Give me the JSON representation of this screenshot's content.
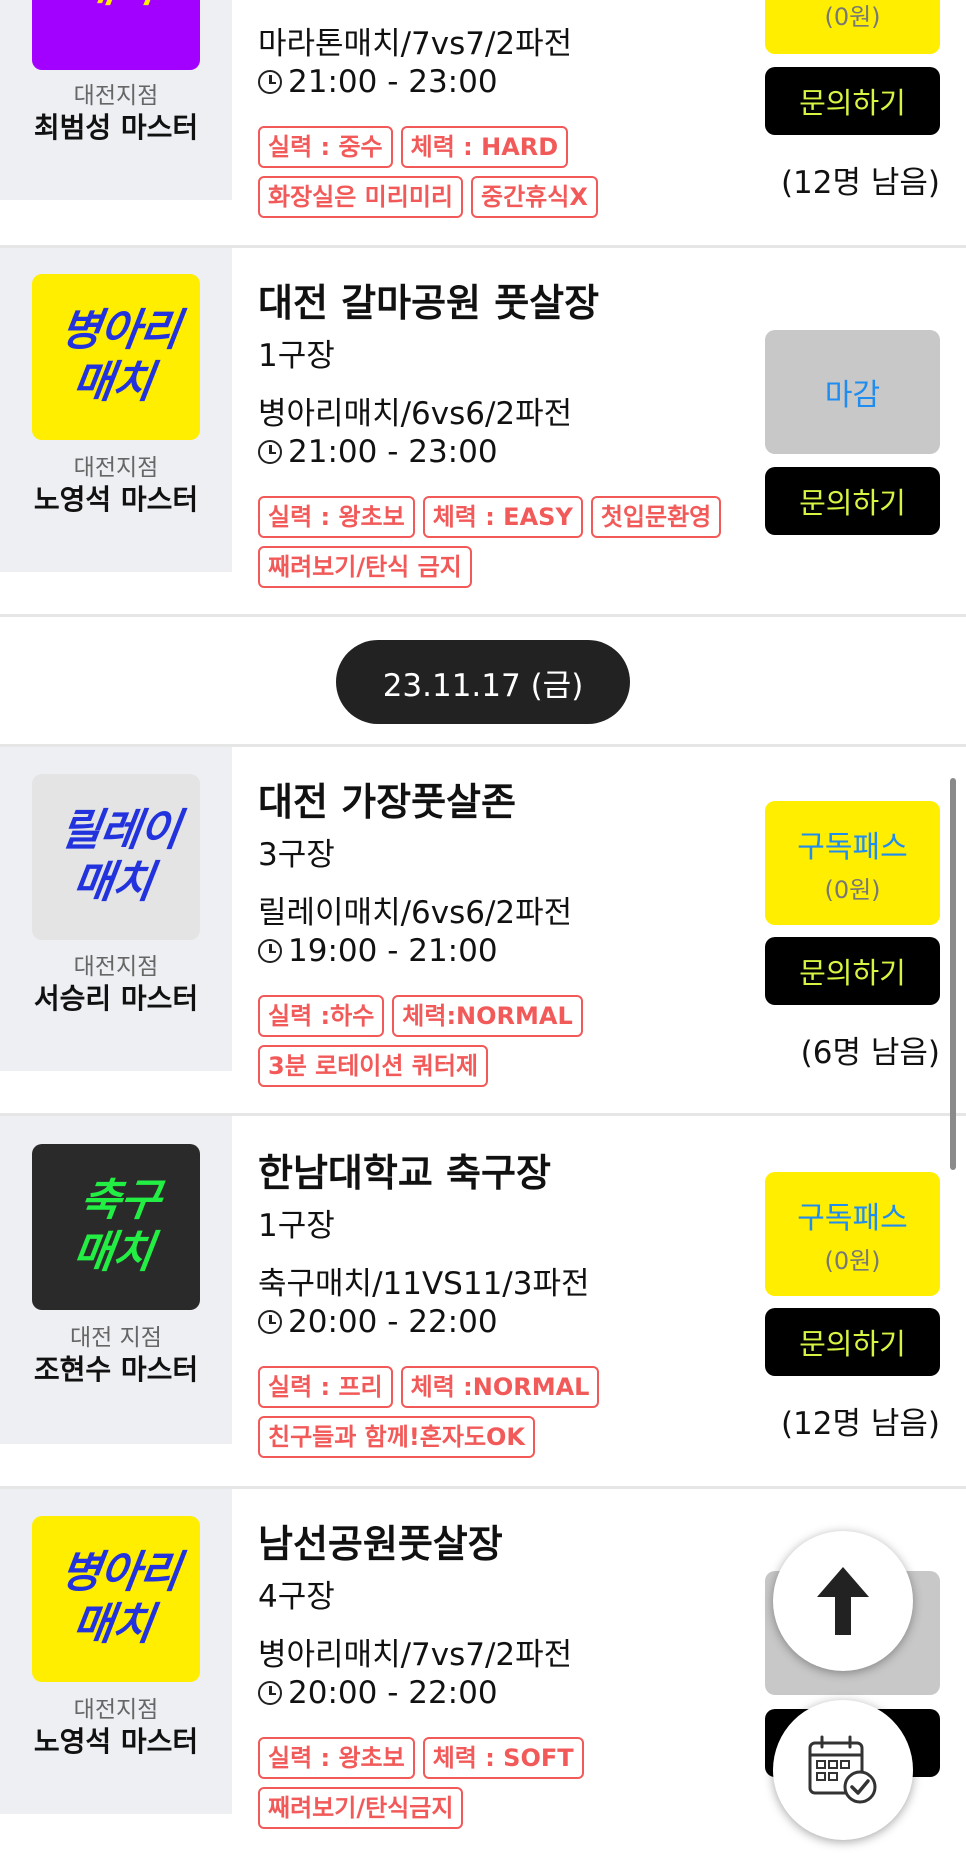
{
  "date_divider": "23.11.17 (금)",
  "cards": [
    {
      "logo_text": "",
      "branch": "대전지점",
      "master": "최범성 마스터",
      "venue": "",
      "court": "",
      "match": "마라톤매치/7vs7/2파전",
      "time": "21:00 - 23:00",
      "tags": [
        "실력 : 중수",
        "체력 : HARD",
        "화장실은 미리미리",
        "중간휴식X"
      ],
      "btn_top_line2": "(0원)",
      "btn_inquiry": "문의하기",
      "remaining": "(12명 남음)"
    },
    {
      "logo_text": "병아리\n매치",
      "branch": "대전지점",
      "master": "노영석 마스터",
      "venue": "대전 갈마공원 풋살장",
      "court": "1구장",
      "match": "병아리매치/6vs6/2파전",
      "time": "21:00 - 23:00",
      "tags": [
        "실력 : 왕초보",
        "체력 : EASY",
        "첫입문환영",
        "째려보기/탄식 금지"
      ],
      "btn_closed": "마감",
      "btn_inquiry": "문의하기"
    },
    {
      "logo_text": "릴레이\n매치",
      "branch": "대전지점",
      "master": "서승리 마스터",
      "venue": "대전 가장풋살존",
      "court": "3구장",
      "match": "릴레이매치/6vs6/2파전",
      "time": "19:00 - 21:00",
      "tags": [
        "실력 :하수",
        "체력:NORMAL",
        "3분 로테이션 쿼터제"
      ],
      "btn_top_line1": "구독패스",
      "btn_top_line2": "(0원)",
      "btn_inquiry": "문의하기",
      "remaining": "(6명 남음)"
    },
    {
      "logo_text": "축구\n매치",
      "branch": "대전 지점",
      "master": "조현수 마스터",
      "venue": "한남대학교 축구장",
      "court": "1구장",
      "match": "축구매치/11VS11/3파전",
      "time": "20:00 - 22:00",
      "tags": [
        "실력 : 프리",
        "체력 :NORMAL",
        "친구들과 함께!혼자도OK"
      ],
      "btn_top_line1": "구독패스",
      "btn_top_line2": "(0원)",
      "btn_inquiry": "문의하기",
      "remaining": "(12명 남음)"
    },
    {
      "logo_text": "병아리\n매치",
      "branch": "대전지점",
      "master": "노영석 마스터",
      "venue": "남선공원풋살장",
      "court": "4구장",
      "match": "병아리매치/7vs7/2파전",
      "time": "20:00 - 22:00",
      "tags": [
        "실력 : 왕초보",
        "체력 : SOFT",
        "째려보기/탄식금지"
      ]
    }
  ],
  "icons": {
    "scroll_top": "arrow-up-icon",
    "calendar": "calendar-check-icon"
  },
  "colors": {
    "tag_red": "#f25a5a",
    "btn_yellow": "#ffee00",
    "btn_link_blue": "#1f8cf0",
    "inquiry_text": "#d6f542",
    "logo_purple": "#a200ff",
    "logo_yellow": "#ffee00",
    "logo_blue_text": "#2233dd",
    "logo_dark": "#2a2a2a",
    "logo_green_text": "#22ee44"
  }
}
